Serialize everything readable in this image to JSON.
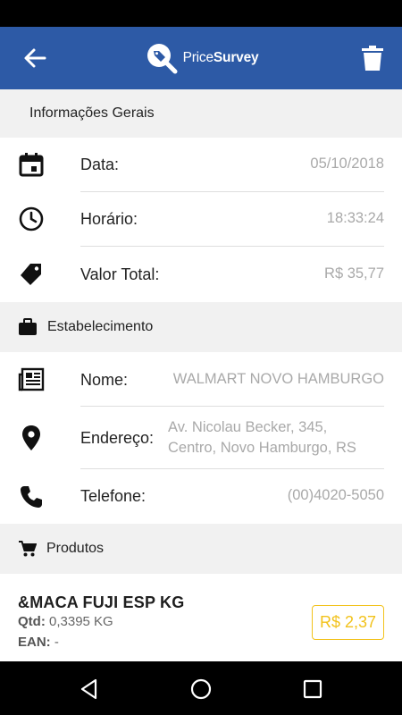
{
  "app": {
    "logo_part1": "Price",
    "logo_part2": "Survey",
    "colors": {
      "primary": "#2d5aa6",
      "accent": "#f2c21b",
      "muted_value": "#a9a9a9"
    }
  },
  "general": {
    "header": "Informações Gerais",
    "rows": [
      {
        "icon": "calendar-icon",
        "label": "Data:",
        "value": "05/10/2018"
      },
      {
        "icon": "clock-icon",
        "label": "Horário:",
        "value": "18:33:24"
      },
      {
        "icon": "price-tag-icon",
        "label": "Valor Total:",
        "value": "R$ 35,77"
      }
    ]
  },
  "establishment": {
    "header": "Estabelecimento",
    "header_icon": "briefcase-icon",
    "rows": [
      {
        "icon": "newspaper-icon",
        "label": "Nome:",
        "value": "WALMART NOVO HAMBURGO"
      },
      {
        "icon": "location-pin-icon",
        "label": "Endereço:",
        "value_line1": "Av. Nicolau Becker, 345,",
        "value_line2": "Centro, Novo Hamburgo, RS"
      },
      {
        "icon": "phone-icon",
        "label": "Telefone:",
        "value": "(00)4020-5050"
      }
    ]
  },
  "products": {
    "header": "Produtos",
    "header_icon": "cart-icon",
    "items": [
      {
        "name": "&MACA FUJI ESP KG",
        "qtd_label": "Qtd:",
        "qtd_value": "0,3395 KG",
        "ean_label": "EAN:",
        "ean_value": "-",
        "price": "R$ 2,37"
      }
    ]
  },
  "navbar": {
    "icons": [
      "back-triangle-icon",
      "home-circle-icon",
      "recents-square-icon"
    ]
  }
}
